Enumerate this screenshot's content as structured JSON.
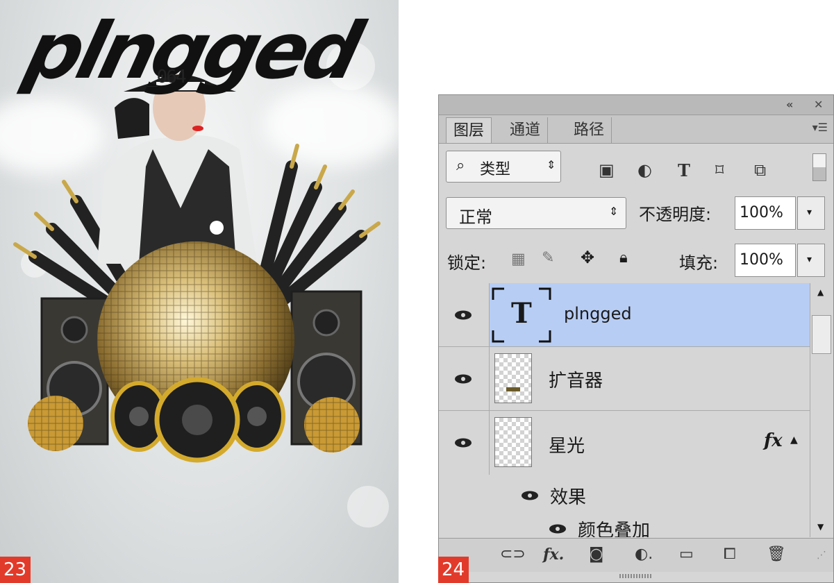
{
  "figures": {
    "left_number": "23",
    "right_number": "24"
  },
  "poster": {
    "logo_text": "plngged",
    "issue_text": "_064"
  },
  "panel": {
    "tabs": [
      {
        "label": "图层",
        "active": true
      },
      {
        "label": "通道",
        "active": false
      },
      {
        "label": "路径",
        "active": false
      }
    ],
    "filter": {
      "label": "类型",
      "icons": [
        "image-filter-icon",
        "adjustment-filter-icon",
        "type-filter-icon",
        "shape-filter-icon",
        "smart-object-filter-icon"
      ]
    },
    "blend": {
      "mode": "正常",
      "opacity_label": "不透明度:",
      "opacity_value": "100%"
    },
    "lock": {
      "label": "锁定:",
      "fill_label": "填充:",
      "fill_value": "100%"
    },
    "layers": [
      {
        "name": "plngged",
        "type": "text",
        "selected": true,
        "visible": true
      },
      {
        "name": "扩音器",
        "type": "pixel",
        "selected": false,
        "visible": true
      },
      {
        "name": "星光",
        "type": "pixel",
        "selected": false,
        "visible": true,
        "fx": "fx"
      }
    ],
    "effects": {
      "label": "效果",
      "items": [
        "颜色叠加"
      ]
    },
    "bottom_icons": [
      "link-layers-icon",
      "fx-icon",
      "mask-icon",
      "adjustment-layer-icon",
      "group-icon",
      "new-layer-icon",
      "delete-icon"
    ],
    "colors": {
      "selected_row": "#b7cdf4",
      "panel_bg": "#d6d6d6",
      "badge": "#e23a2a"
    }
  }
}
